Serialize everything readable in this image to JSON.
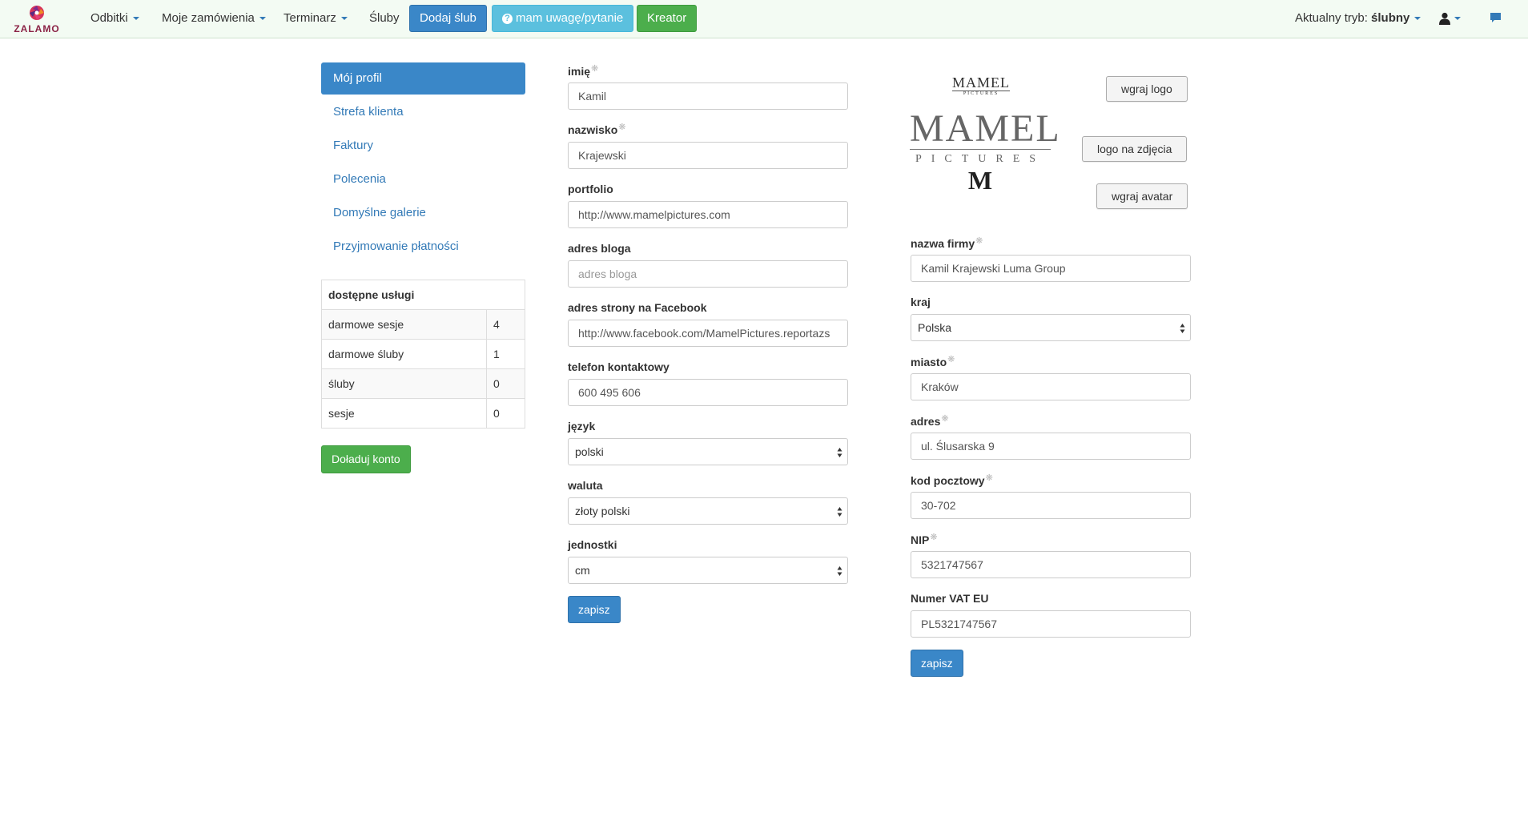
{
  "nav": {
    "logo_text": "ZALAMO",
    "items": [
      {
        "label": "Odbitki"
      },
      {
        "label": "Moje zamówienia"
      },
      {
        "label": "Terminarz"
      },
      {
        "label": "Śluby"
      }
    ],
    "add_wedding_label": "Dodaj ślub",
    "feedback_label": "mam uwagę/pytanie",
    "creator_label": "Kreator",
    "mode_label": "Aktualny tryb:",
    "mode_value": "ślubny"
  },
  "sidebar": {
    "items": [
      {
        "label": "Mój profil"
      },
      {
        "label": "Strefa klienta"
      },
      {
        "label": "Faktury"
      },
      {
        "label": "Polecenia"
      },
      {
        "label": "Domyślne galerie"
      },
      {
        "label": "Przyjmowanie płatności"
      }
    ],
    "services": {
      "header": "dostępne usługi",
      "rows": [
        {
          "name": "darmowe sesje",
          "value": "4"
        },
        {
          "name": "darmowe śluby",
          "value": "1"
        },
        {
          "name": "śluby",
          "value": "0"
        },
        {
          "name": "sesje",
          "value": "0"
        }
      ]
    },
    "topup_label": "Doładuj konto"
  },
  "profile": {
    "first_name": {
      "label": "imię",
      "value": "Kamil"
    },
    "last_name": {
      "label": "nazwisko",
      "value": "Krajewski"
    },
    "portfolio": {
      "label": "portfolio",
      "value": "http://www.mamelpictures.com"
    },
    "blog": {
      "label": "adres bloga",
      "value": "",
      "placeholder": "adres bloga"
    },
    "facebook": {
      "label": "adres strony na Facebook",
      "value": "http://www.facebook.com/MamelPictures.reportazs"
    },
    "phone": {
      "label": "telefon kontaktowy",
      "value": "600 495 606"
    },
    "language": {
      "label": "język",
      "value": "polski"
    },
    "currency": {
      "label": "waluta",
      "value": "złoty polski"
    },
    "units": {
      "label": "jednostki",
      "value": "cm"
    },
    "save_label": "zapisz"
  },
  "company": {
    "brand_small": {
      "title": "MAMEL",
      "subtitle": "PICTURES"
    },
    "brand_big": {
      "title": "MAMEL",
      "subtitle": "PICTURES",
      "mark": "M"
    },
    "upload_logo_label": "wgraj logo",
    "photo_logo_label": "logo na zdjęcia",
    "upload_avatar_label": "wgraj avatar",
    "name": {
      "label": "nazwa firmy",
      "value": "Kamil Krajewski Luma Group"
    },
    "country": {
      "label": "kraj",
      "value": "Polska"
    },
    "city": {
      "label": "miasto",
      "value": "Kraków"
    },
    "address": {
      "label": "adres",
      "value": "ul. Ślusarska 9"
    },
    "postal_code": {
      "label": "kod pocztowy",
      "value": "30-702"
    },
    "nip": {
      "label": "NIP",
      "value": "5321747567"
    },
    "vat_eu": {
      "label": "Numer VAT EU",
      "value": "PL5321747567"
    },
    "save_label": "zapisz"
  },
  "required_mark": "❋",
  "colors": {
    "primary": "#3a87c8",
    "success": "#4cae4c",
    "info": "#5bc0de",
    "link": "#337ab7",
    "navbar_bg": "#f3fbf3"
  }
}
